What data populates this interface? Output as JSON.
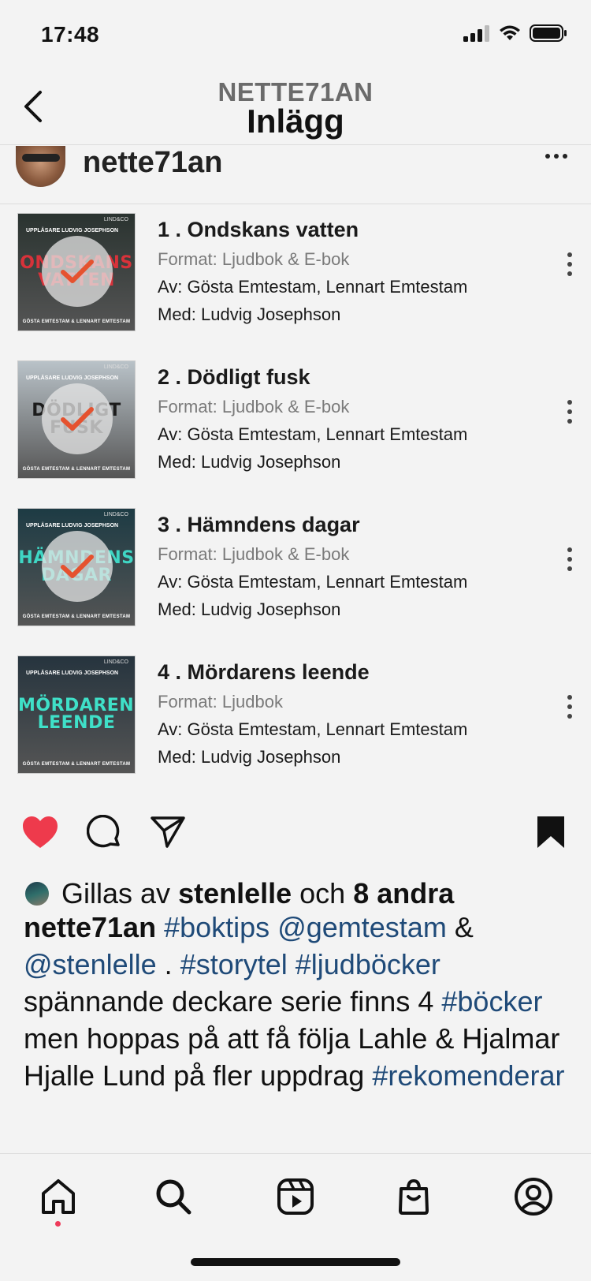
{
  "status": {
    "time": "17:48"
  },
  "nav": {
    "subtitle": "NETTE71AN",
    "title": "Inlägg"
  },
  "post": {
    "username": "nette71an"
  },
  "books": [
    {
      "title": "1 . Ondskans vatten",
      "format": "Format: Ljudbok & E-bok",
      "author": "Av: Gösta Emtestam, Lennart Emtestam",
      "narrator": "Med: Ludvig Josephson",
      "cover_title": "ONDSKANS VATTEN",
      "cover_top": "UPPLÄSARE LUDVIG JOSEPHSON",
      "cover_bottom": "GÖSTA EMTESTAM & LENNART EMTESTAM",
      "cover_logo": "LIND&CO",
      "cover_bg": "#2a3330",
      "cover_title_color": "#d8323a",
      "finished": true
    },
    {
      "title": "2 . Dödligt fusk",
      "format": "Format: Ljudbok & E-bok",
      "author": "Av: Gösta Emtestam, Lennart Emtestam",
      "narrator": "Med: Ludvig Josephson",
      "cover_title": "DÖDLIGT FUSK",
      "cover_top": "UPPLÄSARE LUDVIG JOSEPHSON",
      "cover_bottom": "GÖSTA EMTESTAM & LENNART EMTESTAM",
      "cover_logo": "LIND&CO",
      "cover_bg": "#b9c2c8",
      "cover_title_color": "#1c1c1c",
      "finished": true
    },
    {
      "title": "3 . Hämndens dagar",
      "format": "Format: Ljudbok & E-bok",
      "author": "Av: Gösta Emtestam, Lennart Emtestam",
      "narrator": "Med: Ludvig Josephson",
      "cover_title": "HÄMNDENS DAGAR",
      "cover_top": "UPPLÄSARE LUDVIG JOSEPHSON",
      "cover_bottom": "GÖSTA EMTESTAM & LENNART EMTESTAM",
      "cover_logo": "LIND&CO",
      "cover_bg": "#1d3b44",
      "cover_title_color": "#3fd6c4",
      "finished": true
    },
    {
      "title": "4 . Mördarens leende",
      "format": "Format: Ljudbok",
      "author": "Av: Gösta Emtestam, Lennart Emtestam",
      "narrator": "Med: Ludvig Josephson",
      "cover_title": "MÖRDARENS LEENDE",
      "cover_top": "UPPLÄSARE LUDVIG JOSEPHSON",
      "cover_bottom": "GÖSTA EMTESTAM & LENNART EMTESTAM",
      "cover_logo": "LIND&CO",
      "cover_bg": "#26343e",
      "cover_title_color": "#3fe0c8",
      "finished": false
    }
  ],
  "likes": {
    "prefix": "Gillas av",
    "user": "stenlelle",
    "joiner": "och",
    "others": "8 andra"
  },
  "caption": {
    "username": "nette71an",
    "tag1": "#boktips",
    "mention1": "@gemtestam",
    "amp": "&",
    "mention2": "@stenlelle",
    "dot": ".",
    "tag2": "#storytel",
    "tag3": "#ljudböcker",
    "text1": "spännande deckare serie finns 4",
    "tag4": "#böcker",
    "text2": "men hoppas på att få följa Lahle & Hjalmar Hjalle Lund på fler uppdrag",
    "tag5": "#rekomenderar"
  },
  "colors": {
    "accent": "#1f4a78",
    "like": "#ee3a4c",
    "check": "#e5522f"
  }
}
